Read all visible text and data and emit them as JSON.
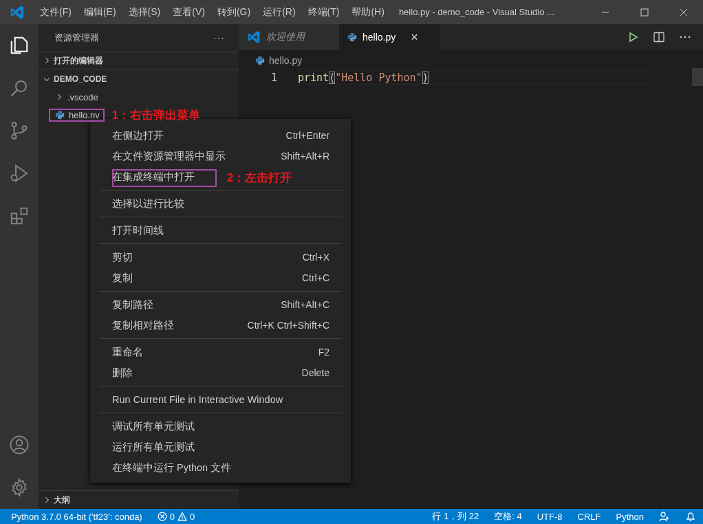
{
  "title_bar": {
    "menus": [
      "文件(F)",
      "编辑(E)",
      "选择(S)",
      "查看(V)",
      "转到(G)",
      "运行(R)",
      "终端(T)",
      "帮助(H)"
    ],
    "title": "hello.py - demo_code - Visual Studio ..."
  },
  "activity_bar": [
    {
      "kind": "explorer",
      "selected": true
    },
    {
      "kind": "search",
      "selected": false
    },
    {
      "kind": "scm",
      "selected": false
    },
    {
      "kind": "debug",
      "selected": false
    },
    {
      "kind": "extensions",
      "selected": false
    }
  ],
  "sidebar": {
    "title": "资源管理器",
    "more": "···",
    "sections": [
      {
        "label": "打开的编辑器",
        "expanded": false
      },
      {
        "label": "DEMO_CODE",
        "expanded": true,
        "children": [
          {
            "kind": "folder",
            "label": ".vscode",
            "expanded": false
          },
          {
            "kind": "python",
            "label": "hello.nv",
            "marked": true,
            "note": "1：右击弹出菜单"
          }
        ]
      }
    ],
    "outline": {
      "label": "大纲",
      "expanded": false
    }
  },
  "editor": {
    "tabs": [
      {
        "label": "欢迎使用",
        "kind": "welcome",
        "selected": false
      },
      {
        "label": "hello.py",
        "kind": "python",
        "selected": true,
        "close": "×"
      }
    ],
    "breadcrumb": "hello.py",
    "lines": [
      {
        "number": "1",
        "tokens": [
          {
            "text": "print",
            "kind": "function"
          },
          {
            "text": "(",
            "kind": "bracket-match"
          },
          {
            "text": "\"Hello Python\"",
            "kind": "string"
          },
          {
            "text": ")",
            "kind": "bracket-match"
          }
        ]
      }
    ]
  },
  "context_menu": {
    "groups": [
      {
        "items": [
          {
            "label": "在侧边打开",
            "shortcut": "Ctrl+Enter"
          },
          {
            "label": "在文件资源管理器中显示",
            "shortcut": "Shift+Alt+R"
          },
          {
            "label": "在集成终端中打开",
            "marked": true,
            "note": "2：左击打开"
          }
        ]
      },
      {
        "items": [
          {
            "label": "选择以进行比较"
          }
        ]
      },
      {
        "items": [
          {
            "label": "打开时间线"
          }
        ]
      },
      {
        "items": [
          {
            "label": "剪切",
            "shortcut": "Ctrl+X"
          },
          {
            "label": "复制",
            "shortcut": "Ctrl+C"
          }
        ]
      },
      {
        "items": [
          {
            "label": "复制路径",
            "shortcut": "Shift+Alt+C"
          },
          {
            "label": "复制相对路径",
            "shortcut": "Ctrl+K Ctrl+Shift+C"
          }
        ]
      },
      {
        "items": [
          {
            "label": "重命名",
            "shortcut": "F2"
          },
          {
            "label": "删除",
            "shortcut": "Delete"
          }
        ]
      },
      {
        "items": [
          {
            "label": "Run Current File in Interactive Window"
          }
        ]
      },
      {
        "items": [
          {
            "label": "调试所有单元测试"
          },
          {
            "label": "运行所有单元测试"
          },
          {
            "label": "在终端中运行 Python 文件"
          }
        ]
      }
    ]
  },
  "status_bar": {
    "interpreter": "Python 3.7.0 64-bit ('tf23': conda)",
    "errors": "0",
    "warnings": "0",
    "position": "行 1，列 22",
    "indent": "空格: 4",
    "encoding": "UTF-8",
    "eol": "CRLF",
    "language": "Python"
  }
}
